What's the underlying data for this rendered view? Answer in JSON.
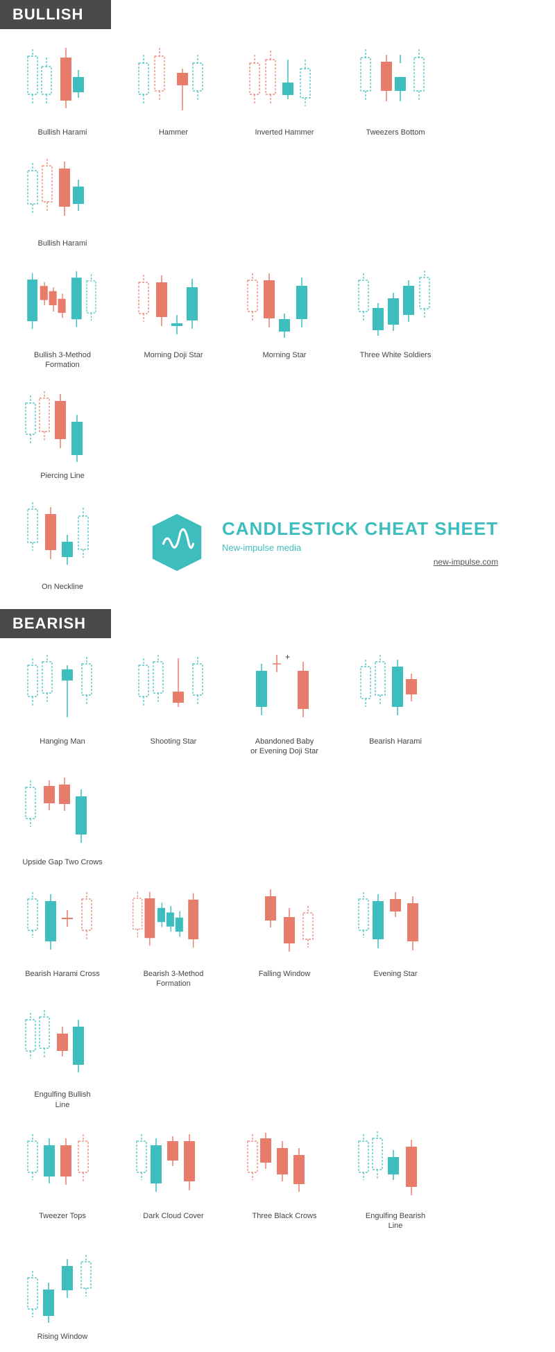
{
  "sections": {
    "bullish": {
      "label": "BULLISH",
      "patterns": [
        {
          "name": "Bullish Harami",
          "candles": "bullish_harami"
        },
        {
          "name": "Hammer",
          "candles": "hammer"
        },
        {
          "name": "Inverted Hammer",
          "candles": "inverted_hammer"
        },
        {
          "name": "Tweezers Bottom",
          "candles": "tweezers_bottom"
        },
        {
          "name": "Bullish Harami",
          "candles": "bullish_harami2"
        },
        {
          "name": "Bullish 3-Method Formation",
          "candles": "bullish_3method"
        },
        {
          "name": "Morning Doji Star",
          "candles": "morning_doji_star"
        },
        {
          "name": "Morning Star",
          "candles": "morning_star"
        },
        {
          "name": "Three White Soldiers",
          "candles": "three_white_soldiers"
        },
        {
          "name": "Piercing Line",
          "candles": "piercing_line"
        },
        {
          "name": "On Neckline",
          "candles": "on_neckline"
        }
      ]
    },
    "bearish": {
      "label": "BEARISH",
      "patterns": [
        {
          "name": "Hanging Man",
          "candles": "hanging_man"
        },
        {
          "name": "Shooting Star",
          "candles": "shooting_star"
        },
        {
          "name": "Abandoned Baby or Evening Doji Star",
          "candles": "abandoned_baby"
        },
        {
          "name": "Bearish Harami",
          "candles": "bearish_harami"
        },
        {
          "name": "Upside Gap Two Crows",
          "candles": "upside_gap_two_crows"
        },
        {
          "name": "Bearish Harami Cross",
          "candles": "bearish_harami_cross"
        },
        {
          "name": "Bearish 3-Method Formation",
          "candles": "bearish_3method"
        },
        {
          "name": "Falling Window",
          "candles": "falling_window"
        },
        {
          "name": "Evening Star",
          "candles": "evening_star"
        },
        {
          "name": "Engulfing Bullish Line",
          "candles": "engulfing_bullish"
        },
        {
          "name": "Tweezer Tops",
          "candles": "tweezer_tops"
        },
        {
          "name": "Dark Cloud Cover",
          "candles": "dark_cloud_cover"
        },
        {
          "name": "Three Black Crows",
          "candles": "three_black_crows"
        },
        {
          "name": "Engulfing Bearish Line",
          "candles": "engulfing_bearish"
        },
        {
          "name": "Rising Window",
          "candles": "rising_window"
        }
      ]
    }
  },
  "banner": {
    "title": "CANDLESTICK CHEAT SHEET",
    "brand": "New-impulse media",
    "url": "new-impulse.com"
  }
}
